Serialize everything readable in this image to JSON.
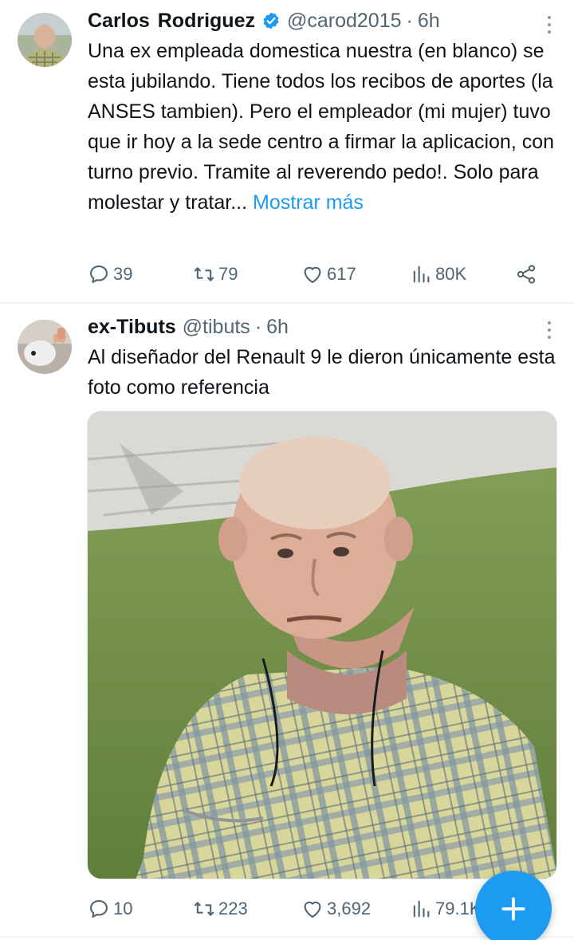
{
  "tweets": [
    {
      "author_name": "Carlos  Rodriguez",
      "verified": true,
      "handle": "@carod2015",
      "time": "6h",
      "text": "Una ex empleada domestica nuestra (en blanco) se esta jubilando. Tiene todos los recibos de aportes (la ANSES  tambien). Pero el empleador (mi mujer) tuvo que ir hoy a la sede centro a firmar la aplicacion, con turno previo. Tramite al reverendo pedo!. Solo para molestar y tratar...",
      "show_more": "Mostrar más",
      "replies": "39",
      "retweets": "79",
      "likes": "617",
      "views": "80K"
    },
    {
      "author_name": "ex-Tibuts",
      "handle": "@tibuts",
      "time": "6h",
      "text": "Al diseñador del Renault 9 le dieron únicamente esta foto como referencia",
      "replies": "10",
      "retweets": "223",
      "likes": "3,692",
      "views": "79.1K"
    }
  ],
  "separator": "·",
  "icons": {
    "verified": "verified-badge-icon",
    "more": "more-vertical-icon",
    "reply": "reply-icon",
    "retweet": "retweet-icon",
    "like": "heart-icon",
    "views": "views-bar-chart-icon",
    "share": "share-icon",
    "compose": "plus-icon"
  },
  "colors": {
    "accent": "#1d9bf0",
    "text_primary": "#0f1419",
    "text_secondary": "#536471",
    "divider": "#eff3f4"
  }
}
